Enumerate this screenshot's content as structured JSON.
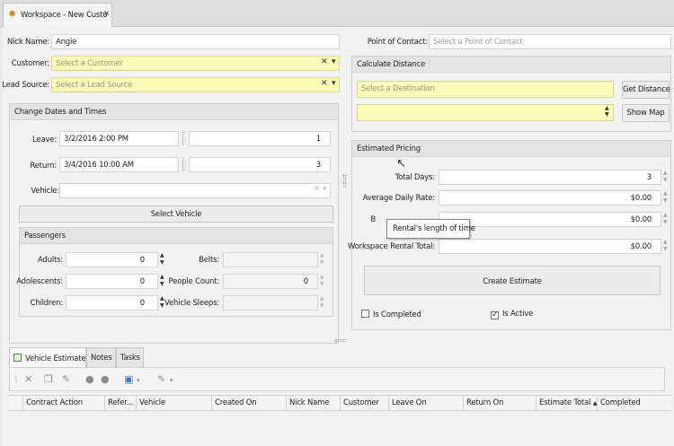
{
  "tab": {
    "title": "Workspace - New Custo",
    "close": "✕"
  },
  "customer_form": {
    "nick_name_label": "Nick Name:",
    "nick_name_value": "Angie",
    "customer_label": "Customer:",
    "customer_placeholder": "Select a Customer",
    "lead_source_label": "Lead Source:",
    "lead_source_placeholder": "Select a Lead Source",
    "clear_glyph": "✕",
    "dropdown_glyph": "▾"
  },
  "contact": {
    "label": "Point of Contact:",
    "placeholder": "Select a Point of Contact"
  },
  "dates": {
    "title": "Change Dates and Times",
    "leave_label": "Leave:",
    "leave_value": "3/2/2016 2:00 PM",
    "leave_days": "1",
    "return_label": "Return:",
    "return_value": "3/4/2016 10:00 AM",
    "return_days": "3",
    "vehicle_label": "Vehicle:",
    "select_vehicle_label": "Select Vehicle"
  },
  "passengers": {
    "title": "Passengers",
    "adults_label": "Adults:",
    "adults_value": "0",
    "adolescents_label": "Adolescents:",
    "adolescents_value": "0",
    "children_label": "Children:",
    "children_value": "0",
    "belts_label": "Belts:",
    "people_count_label": "People Count:",
    "people_count_value": "0",
    "vehicle_sleeps_label": "Vehicle Sleeps:"
  },
  "distance": {
    "title": "Calculate Distance",
    "destination_placeholder": "Select a Destination",
    "get_distance_label": "Get Distance",
    "show_map_label": "Show Map"
  },
  "pricing": {
    "title": "Estimated Pricing",
    "total_days_label": "Total Days:",
    "total_days_value": "3",
    "avg_daily_rate_label": "Average Daily Rate:",
    "avg_daily_rate_value": "$0.00",
    "third_label": "B",
    "third_value": "$0.00",
    "workspace_rental_total_label": "Workspace Rental Total:",
    "workspace_rental_total_value": "$0.00",
    "create_estimate_label": "Create Estimate",
    "is_completed_label": "Is Completed",
    "is_completed_checked": false,
    "is_active_label": "Is Active",
    "is_active_checked": true,
    "tooltip": "Rental's length of time"
  },
  "bottom_tabs": [
    {
      "label": "Vehicle Estimates",
      "active": true
    },
    {
      "label": "Notes",
      "active": false
    },
    {
      "label": "Tasks",
      "active": false
    }
  ],
  "grid": {
    "columns": [
      "Contract Action",
      "Refer...",
      "Vehicle",
      "Created On",
      "Nick Name",
      "Customer",
      "Leave On",
      "Return On",
      "Estimate Total",
      "Completed"
    ],
    "sort_glyph": "▲"
  },
  "spin": {
    "up": "▲",
    "down": "▼"
  },
  "colors": {
    "required_field": "#fafbb9",
    "panel": "#f2f2f2",
    "tab_icon": "#d8842a"
  }
}
